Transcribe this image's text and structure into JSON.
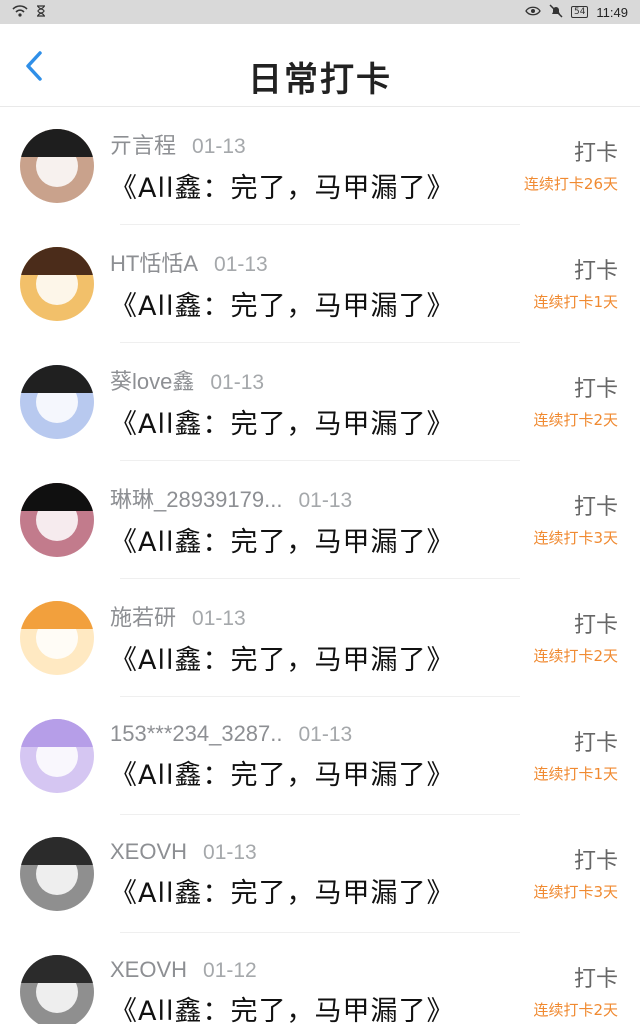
{
  "status": {
    "time": "11:49",
    "battery": "54"
  },
  "header": {
    "title": "日常打卡"
  },
  "list": [
    {
      "user": "亓言程",
      "date": "01-13",
      "book": "《All鑫：完了，马甲漏了》",
      "punch": "打卡",
      "streak": "连续打卡26天",
      "avatar_color": "#c9a28c",
      "hair_color": "#1e1e1e"
    },
    {
      "user": "HT恬恬A",
      "date": "01-13",
      "book": "《All鑫：完了，马甲漏了》",
      "punch": "打卡",
      "streak": "连续打卡1天",
      "avatar_color": "#f2c06a",
      "hair_color": "#4b2c1a"
    },
    {
      "user": "葵love鑫",
      "date": "01-13",
      "book": "《All鑫：完了，马甲漏了》",
      "punch": "打卡",
      "streak": "连续打卡2天",
      "avatar_color": "#b8c9ef",
      "hair_color": "#202020"
    },
    {
      "user": "琳琳_28939179...",
      "date": "01-13",
      "book": "《All鑫：完了，马甲漏了》",
      "punch": "打卡",
      "streak": "连续打卡3天",
      "avatar_color": "#c27b8c",
      "hair_color": "#101010"
    },
    {
      "user": "施若研",
      "date": "01-13",
      "book": "《All鑫：完了，马甲漏了》",
      "punch": "打卡",
      "streak": "连续打卡2天",
      "avatar_color": "#ffe9c2",
      "hair_color": "#f2a03d"
    },
    {
      "user": "153***234_3287..",
      "date": "01-13",
      "book": "《All鑫：完了，马甲漏了》",
      "punch": "打卡",
      "streak": "连续打卡1天",
      "avatar_color": "#d5c6f2",
      "hair_color": "#b69ee8"
    },
    {
      "user": "XEOVH",
      "date": "01-13",
      "book": "《All鑫：完了，马甲漏了》",
      "punch": "打卡",
      "streak": "连续打卡3天",
      "avatar_color": "#8f8f8f",
      "hair_color": "#2b2b2b"
    },
    {
      "user": "XEOVH",
      "date": "01-12",
      "book": "《All鑫：完了，马甲漏了》",
      "punch": "打卡",
      "streak": "连续打卡2天",
      "avatar_color": "#8f8f8f",
      "hair_color": "#2b2b2b"
    }
  ],
  "colors": {
    "accent_blue": "#2f8fe8",
    "streak_orange": "#f08a31"
  }
}
